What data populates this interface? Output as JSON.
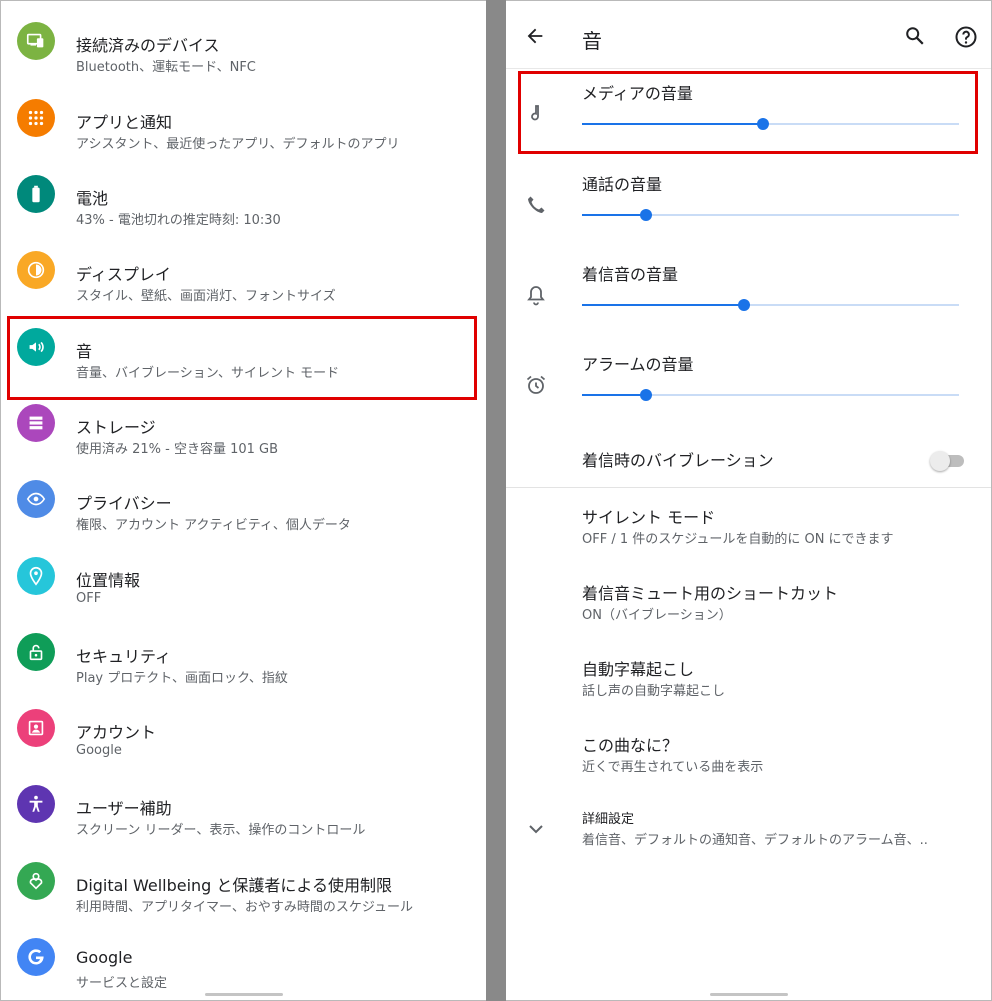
{
  "left": {
    "items": [
      {
        "title": "接続済みのデバイス",
        "subtitle": "Bluetooth、運転モード、NFC",
        "icon": "connected-devices-icon",
        "color": "#7cb342"
      },
      {
        "title": "アプリと通知",
        "subtitle": "アシスタント、最近使ったアプリ、デフォルトのアプリ",
        "icon": "apps-icon",
        "color": "#f57c00"
      },
      {
        "title": "電池",
        "subtitle": "43% - 電池切れの推定時刻: 10:30",
        "icon": "battery-icon",
        "color": "#00897b"
      },
      {
        "title": "ディスプレイ",
        "subtitle": "スタイル、壁紙、画面消灯、フォントサイズ",
        "icon": "display-icon",
        "color": "#f9a825"
      },
      {
        "title": "音",
        "subtitle": "音量、バイブレーション、サイレント モード",
        "icon": "sound-icon",
        "color": "#00a99d"
      },
      {
        "title": "ストレージ",
        "subtitle": "使用済み 21% - 空き容量 101 GB",
        "icon": "storage-icon",
        "color": "#ab47bc"
      },
      {
        "title": "プライバシー",
        "subtitle": "権限、アカウント アクティビティ、個人データ",
        "icon": "privacy-icon",
        "color": "#4f8be6"
      },
      {
        "title": "位置情報",
        "subtitle": "OFF",
        "icon": "location-icon",
        "color": "#26c6da"
      },
      {
        "title": "セキュリティ",
        "subtitle": "Play プロテクト、画面ロック、指紋",
        "icon": "security-icon",
        "color": "#0f9d58"
      },
      {
        "title": "アカウント",
        "subtitle": "Google",
        "icon": "account-icon",
        "color": "#ec407a"
      },
      {
        "title": "ユーザー補助",
        "subtitle": "スクリーン リーダー、表示、操作のコントロール",
        "icon": "accessibility-icon",
        "color": "#5e35b1"
      },
      {
        "title": "Digital Wellbeing と保護者による使用制限",
        "subtitle": "利用時間、アプリタイマー、おやすみ時間のスケジュール",
        "icon": "wellbeing-icon",
        "color": "#34a853"
      },
      {
        "title": "Google",
        "subtitle": "サービスと設定",
        "icon": "google-icon",
        "color": "#4285f4"
      }
    ]
  },
  "right": {
    "title": "音",
    "volumes": [
      {
        "label": "メディアの音量",
        "icon": "music-note-icon",
        "level": 0.48
      },
      {
        "label": "通話の音量",
        "icon": "phone-icon",
        "level": 0.17
      },
      {
        "label": "着信音の音量",
        "icon": "bell-icon",
        "level": 0.43
      },
      {
        "label": "アラームの音量",
        "icon": "alarm-icon",
        "level": 0.17
      }
    ],
    "vibrate_label": "着信時のバイブレーション",
    "vibrate_on": false,
    "options": [
      {
        "title": "サイレント モード",
        "subtitle": "OFF / 1 件のスケジュールを自動的に ON にできます"
      },
      {
        "title": "着信音ミュート用のショートカット",
        "subtitle": "ON（バイブレーション）"
      },
      {
        "title": "自動字幕起こし",
        "subtitle": "話し声の自動字幕起こし"
      },
      {
        "title": "この曲なに？",
        "subtitle": "近くで再生されている曲を表示"
      }
    ],
    "advanced": {
      "title": "詳細設定",
      "subtitle": "着信音、デフォルトの通知音、デフォルトのアラーム音、.."
    }
  },
  "colors": {
    "accent": "#1a73e8",
    "highlight": "#e00000"
  }
}
